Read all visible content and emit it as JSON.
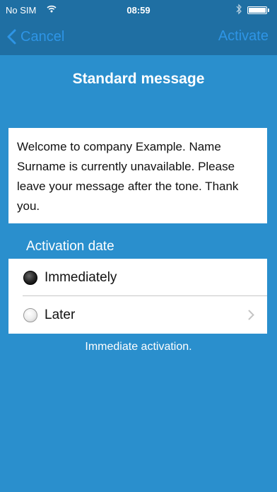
{
  "status_bar": {
    "carrier": "No SIM",
    "time": "08:59",
    "wifi_icon": "wifi-icon",
    "bluetooth_icon": "bluetooth-icon",
    "battery_level": 1.0
  },
  "nav": {
    "cancel_label": "Cancel",
    "activate_label": "Activate",
    "accent_color": "#2e95e6"
  },
  "page": {
    "title": "Standard message"
  },
  "message": {
    "text": "Welcome to company Example. Name Surname is currently unavailable. Please leave your message after the tone. Thank you."
  },
  "activation": {
    "section_label": "Activation date",
    "options": [
      {
        "label": "Immediately",
        "selected": true
      },
      {
        "label": "Later",
        "selected": false
      }
    ],
    "note": "Immediate activation."
  },
  "colors": {
    "background": "#2a8fcd",
    "nav_bar": "#1f6fa3"
  }
}
